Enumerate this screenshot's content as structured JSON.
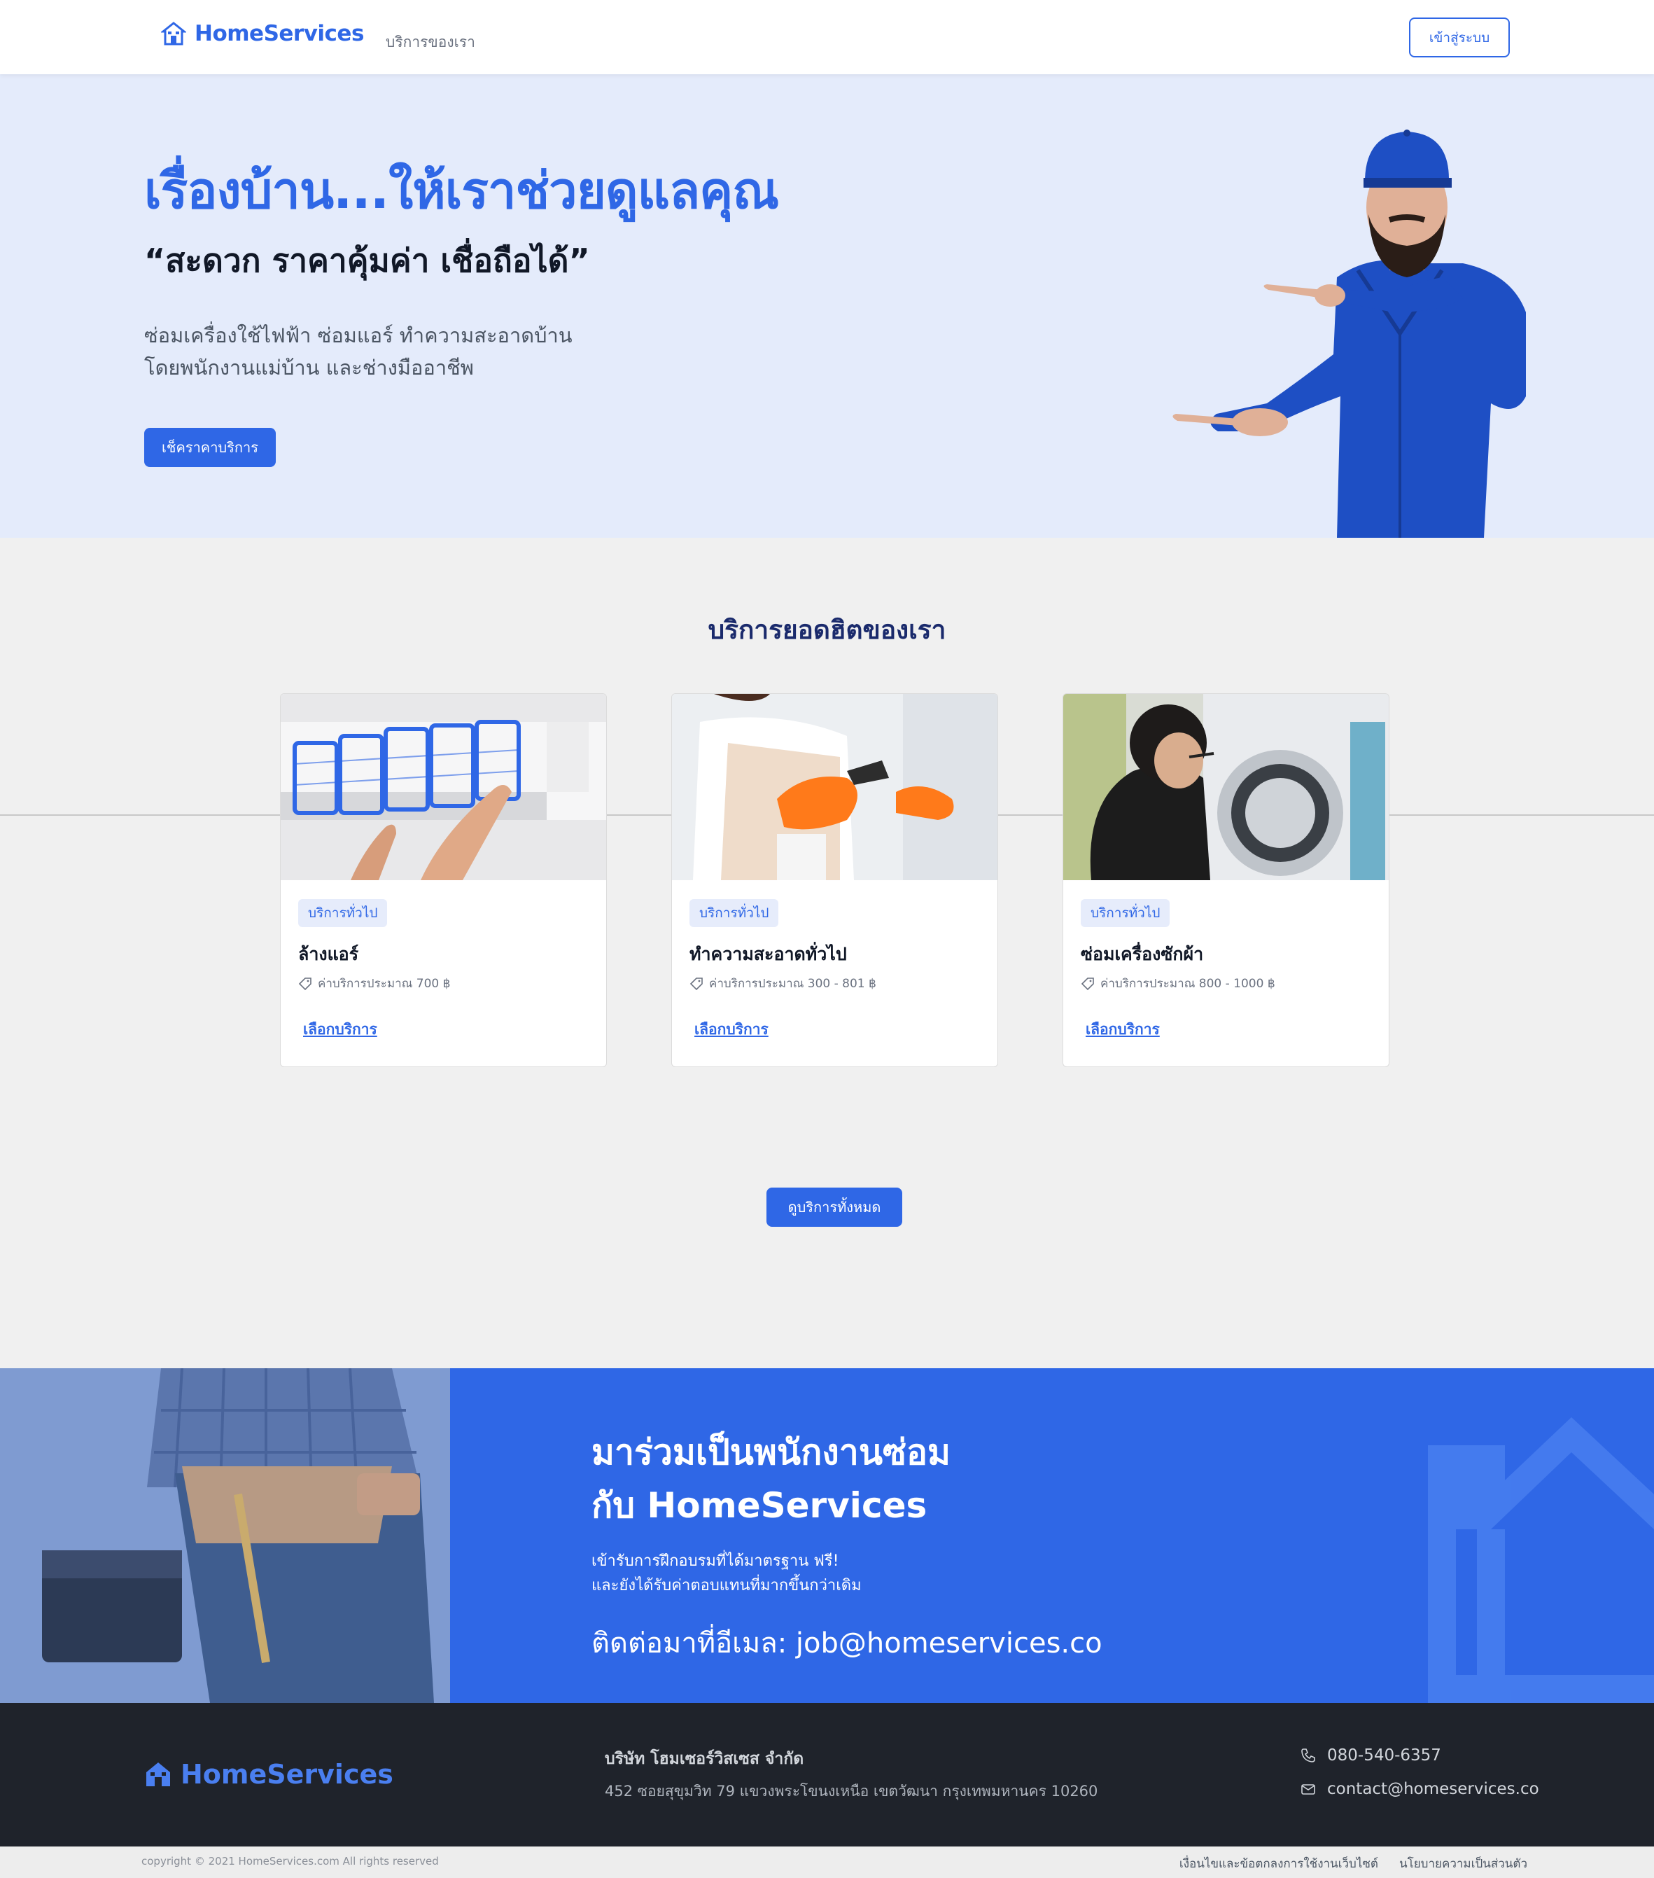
{
  "nav": {
    "brand": "HomeServices",
    "link": "บริการของเรา",
    "login": "เข้าสู่ระบบ"
  },
  "hero": {
    "title": "เรื่องบ้าน...ให้เราช่วยดูแลคุณ",
    "subtitle": "“สะดวก ราคาคุ้มค่า เชื่อถือได้”",
    "desc_line1": "ซ่อมเครื่องใช้ไฟฟ้า ซ่อมแอร์ ทำความสะอาดบ้าน",
    "desc_line2": "โดยพนักงานแม่บ้าน และช่างมืออาชีพ",
    "button": "เช็คราคาบริการ"
  },
  "services": {
    "heading": "บริการยอดฮิตของเรา",
    "cards": [
      {
        "badge": "บริการทั่วไป",
        "title": "ล้างแอร์",
        "price": "ค่าบริการประมาณ 700 ฿",
        "link": "เลือกบริการ"
      },
      {
        "badge": "บริการทั่วไป",
        "title": "ทำความสะอาดทั่วไป",
        "price": "ค่าบริการประมาณ 300 - 801 ฿",
        "link": "เลือกบริการ"
      },
      {
        "badge": "บริการทั่วไป",
        "title": "ซ่อมเครื่องซักผ้า",
        "price": "ค่าบริการประมาณ 800 - 1000 ฿",
        "link": "เลือกบริการ"
      }
    ],
    "all_button": "ดูบริการทั้งหมด"
  },
  "recruit": {
    "heading_line1": "มาร่วมเป็นพนักงานซ่อม",
    "heading_line2": "กับ HomeServices",
    "text_line1": "เข้ารับการฝึกอบรมที่ได้มาตรฐาน ฟรี!",
    "text_line2": "และยังได้รับค่าตอบแทนที่มากขึ้นกว่าเดิม",
    "contact": "ติดต่อมาที่อีเมล: job@homeservices.co"
  },
  "footer": {
    "brand": "HomeServices",
    "company": "บริษัท โฮมเซอร์วิสเซส จำกัด",
    "address": "452 ซอยสุขุมวิท 79 แขวงพระโขนงเหนือ เขตวัฒนา กรุงเทพมหานคร 10260",
    "phone": "080-540-6357",
    "email": "contact@homeservices.co",
    "copyright": "copyright © 2021 HomeServices.com All rights reserved",
    "terms": "เงื่อนไขและข้อตกลงการใช้งานเว็บไซต์",
    "privacy": "นโยบายความเป็นส่วนตัว"
  },
  "colors": {
    "primary": "#2f67e6",
    "hero_bg": "#e4ebfb",
    "footer_bg": "#1f232b",
    "page_bg": "#f0f0f0"
  }
}
